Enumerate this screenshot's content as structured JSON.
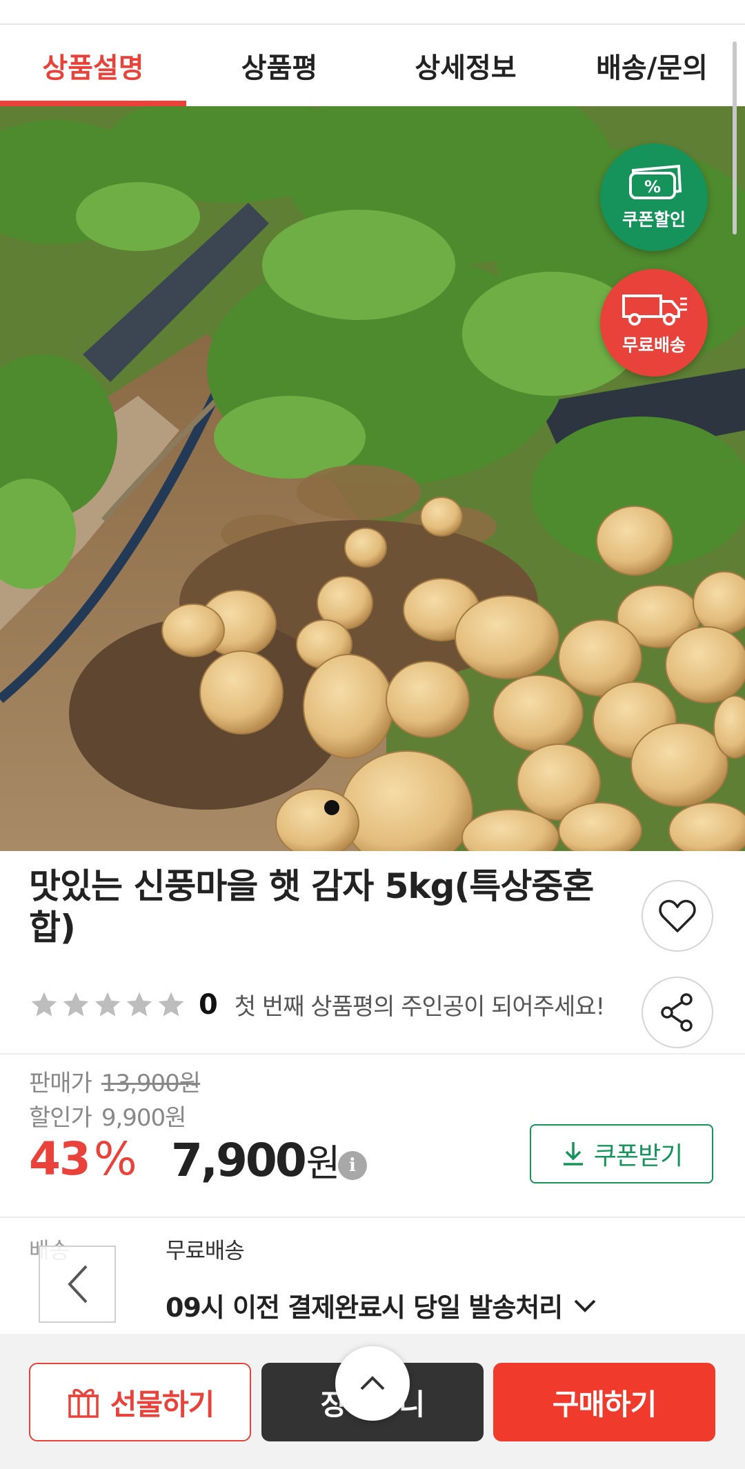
{
  "tabs": [
    {
      "label": "상품설명",
      "active": true
    },
    {
      "label": "상품평"
    },
    {
      "label": "상세정보"
    },
    {
      "label": "배송/문의"
    }
  ],
  "badges": {
    "coupon_label": "쿠폰할인",
    "coupon_symbol": "%",
    "shipping_label": "무료배송"
  },
  "product": {
    "title": "맛있는 신풍마을 햇 감자 5kg(특상중혼합)",
    "rating_count": "0",
    "review_prompt": "첫 번째 상품평의 주인공이 되어주세요!"
  },
  "price": {
    "sale_label": "판매가",
    "sale_value": "13,900원",
    "discount_label": "할인가",
    "discount_value": "9,900원",
    "percent_number": "43",
    "percent_sign": "%",
    "final_number": "7,900",
    "final_unit": "원",
    "info_symbol": "i",
    "coupon_button": "쿠폰받기"
  },
  "shipping": {
    "label": "배송",
    "value": "무료배송",
    "note": "09시 이전 결제완료시 당일 발송처리"
  },
  "bottom_bar": {
    "gift": "선물하기",
    "cart": "장바구니",
    "buy": "구매하기"
  },
  "colors": {
    "accent_red": "#e8423a",
    "coupon_green": "#15935b",
    "dark_button": "#333333"
  },
  "icons": [
    "coupon-icon",
    "truck-icon",
    "heart-icon",
    "share-icon",
    "star-icon",
    "info-icon",
    "download-icon",
    "chevron-down-icon",
    "chevron-left-icon",
    "gift-icon",
    "chevron-up-icon"
  ]
}
